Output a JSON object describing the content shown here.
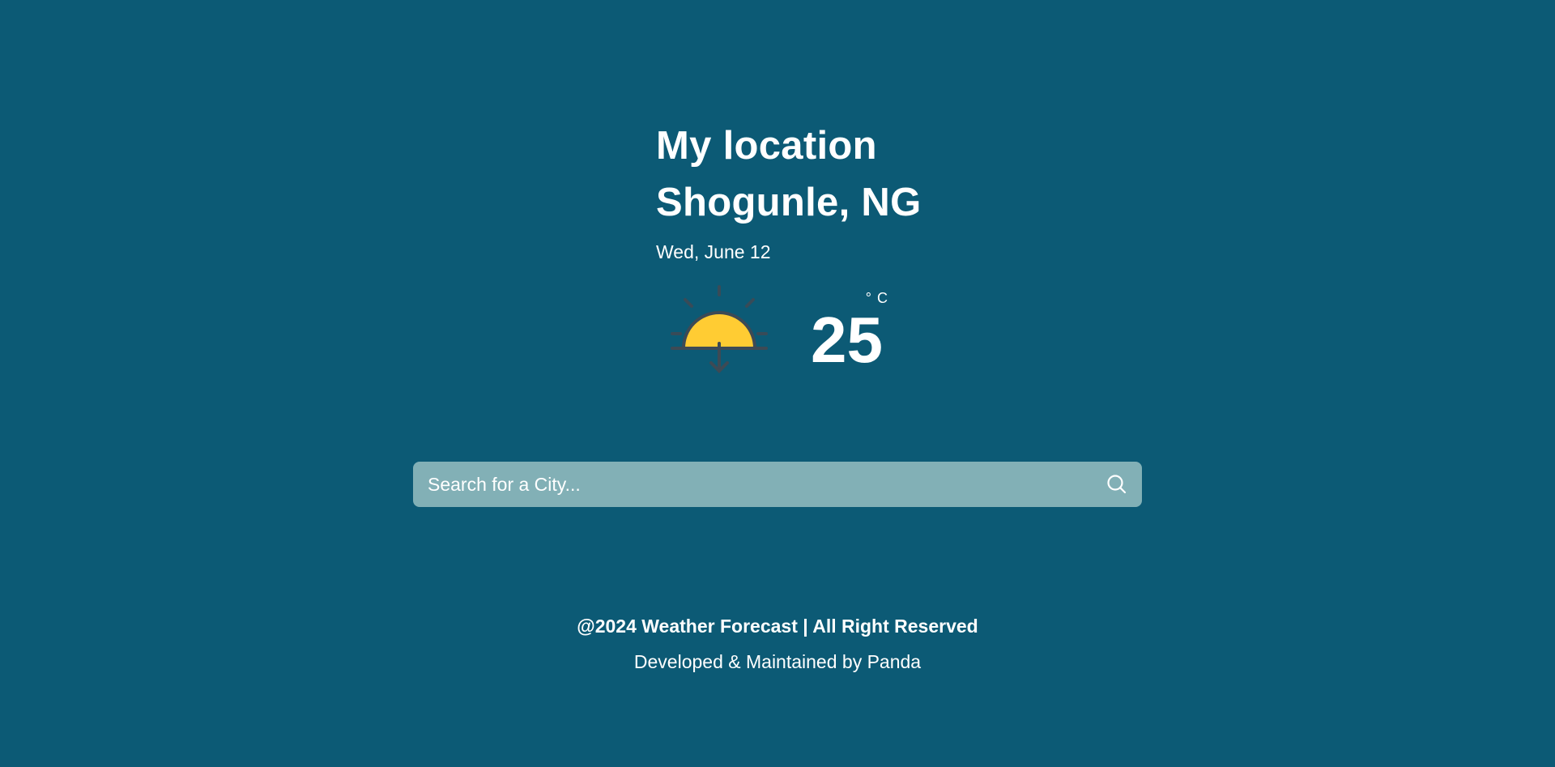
{
  "location": {
    "label": "My location",
    "city": "Shogunle, NG",
    "date": "Wed, June 12"
  },
  "weather": {
    "icon": "sunset-icon",
    "temperature": "25",
    "unit": "° C"
  },
  "search": {
    "placeholder": "Search for a City..."
  },
  "footer": {
    "copyright": "@2024 Weather Forecast | All Right Reserved",
    "credit": "Developed & Maintained by Panda"
  },
  "colors": {
    "background": "#0c5a75",
    "search_background": "#82b0b6",
    "sun": "#ffcc33",
    "sun_outline": "#3d4a55"
  }
}
